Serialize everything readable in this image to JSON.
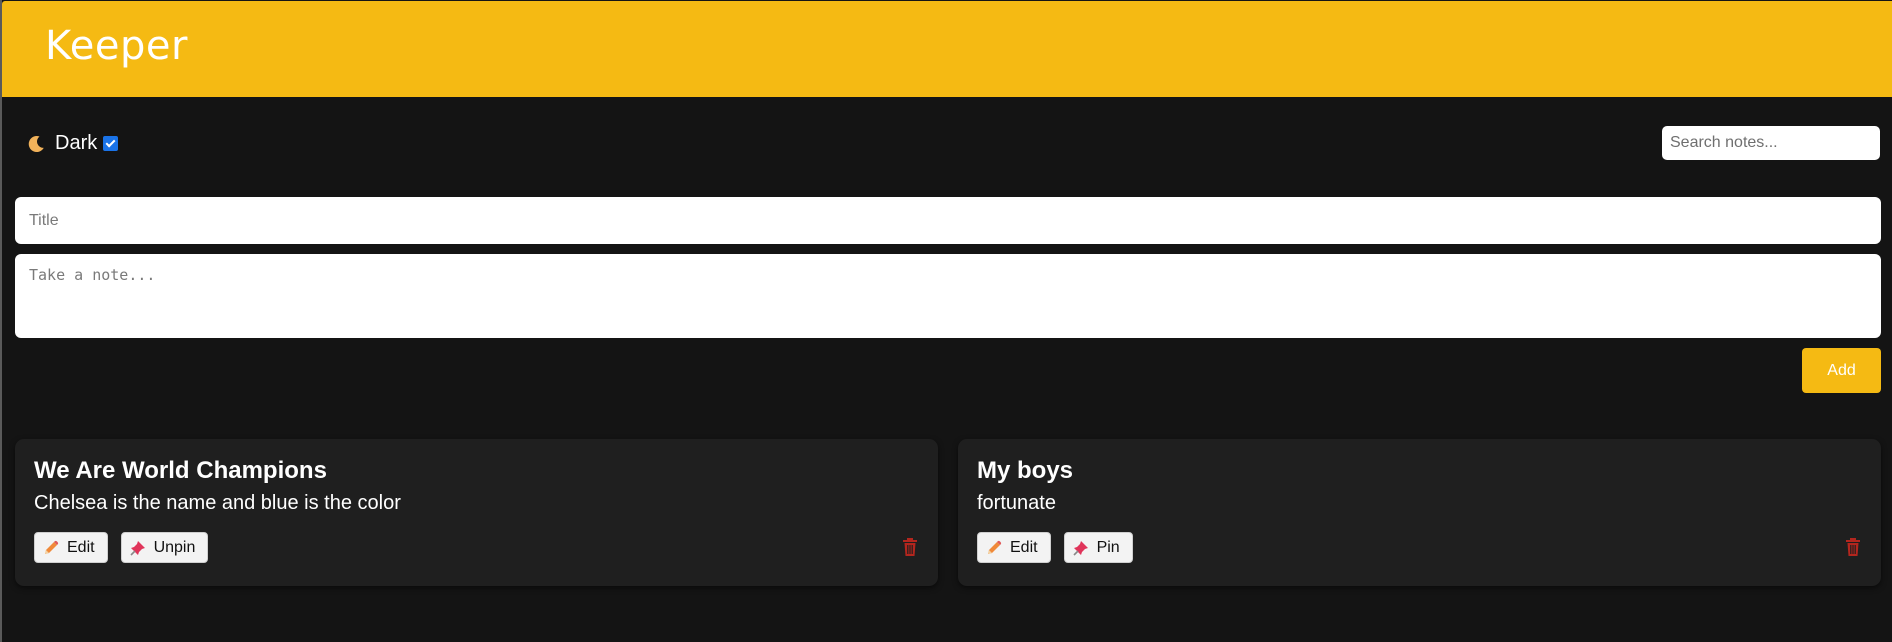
{
  "app": {
    "title": "Keeper"
  },
  "toolbar": {
    "theme_label": "Dark",
    "theme_checked": true,
    "search_placeholder": "Search notes..."
  },
  "composer": {
    "title_placeholder": "Title",
    "note_placeholder": "Take a note...",
    "add_label": "Add"
  },
  "notes": [
    {
      "title": "We Are World Champions",
      "body": "Chelsea is the name and blue is the color",
      "edit_label": "Edit",
      "pin_label": "Unpin"
    },
    {
      "title": "My boys",
      "body": "fortunate",
      "edit_label": "Edit",
      "pin_label": "Pin"
    }
  ],
  "icons": {
    "theme": "moon-icon",
    "edit": "pencil-icon",
    "pin": "pushpin-icon",
    "delete": "trash-icon"
  },
  "colors": {
    "accent": "#f5ba13",
    "background": "#141414",
    "card": "#1f1f1f",
    "delete": "#b3261e"
  }
}
